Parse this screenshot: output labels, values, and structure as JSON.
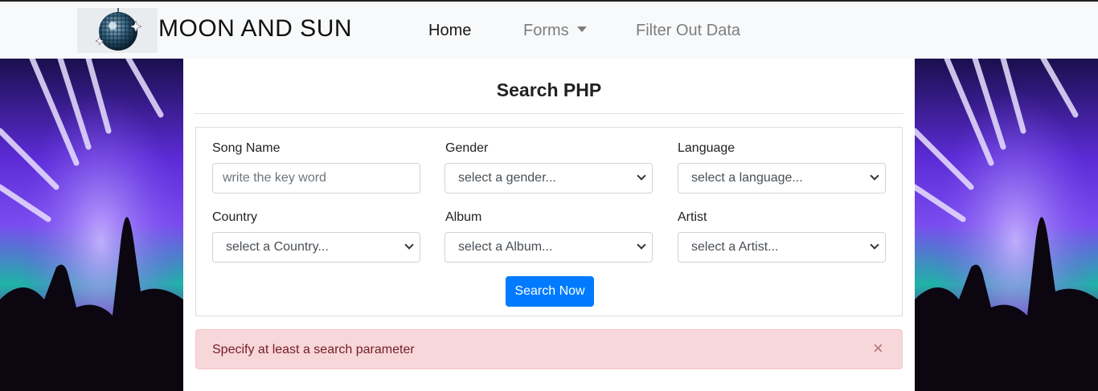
{
  "navbar": {
    "brand_name": "MOON AND SUN",
    "items": [
      {
        "label": "Home",
        "active": true
      },
      {
        "label": "Forms",
        "dropdown": true
      },
      {
        "label": "Filter Out Data"
      }
    ]
  },
  "main": {
    "title": "Search PHP",
    "fields": {
      "song_name": {
        "label": "Song Name",
        "placeholder": "write the key word"
      },
      "gender": {
        "label": "Gender",
        "selected": "select a gender..."
      },
      "language": {
        "label": "Language",
        "selected": "select a language..."
      },
      "country": {
        "label": "Country",
        "selected": "select a Country..."
      },
      "album": {
        "label": "Album",
        "selected": "select a Album..."
      },
      "artist": {
        "label": "Artist",
        "selected": "select a Artist..."
      }
    },
    "search_button": "Search Now",
    "alert": {
      "text": "Specify at least a search parameter",
      "close": "×"
    }
  },
  "colors": {
    "navbar_bg": "#f8f9fa",
    "primary": "#007bff",
    "alert_bg": "#f8d7da",
    "alert_text": "#721c24"
  },
  "icons": [
    "disco-ball-logo-icon",
    "caret-down-icon",
    "chevron-down-icon",
    "close-icon"
  ]
}
